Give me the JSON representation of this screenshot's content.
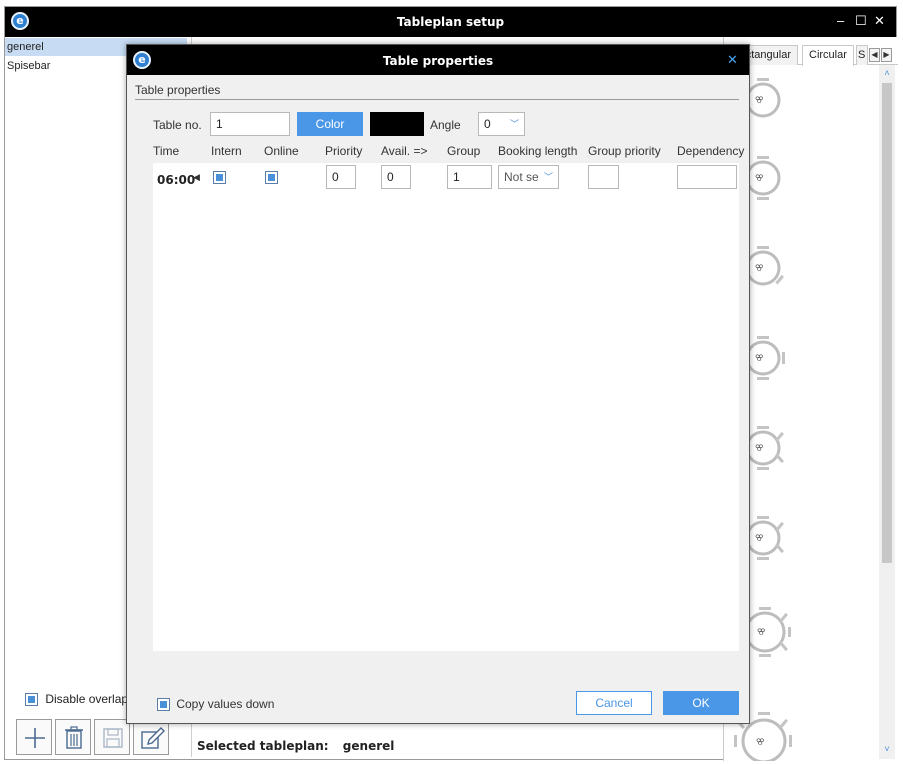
{
  "main_window": {
    "title": "Tableplan setup",
    "controls": {
      "minimize": "–",
      "maximize": "☐",
      "close": "✕"
    }
  },
  "left_list": {
    "items": [
      "generel",
      "Spisebar"
    ],
    "selected": "generel"
  },
  "right_panel": {
    "tabs": [
      {
        "label": "Rectangular",
        "active": false
      },
      {
        "label": "Circular",
        "active": true
      },
      {
        "label": "S",
        "active": false
      }
    ],
    "tab_arrows": {
      "left": "◀",
      "right": "▶"
    },
    "scroll": {
      "up": "˄",
      "down": "˅"
    },
    "table_icon_glyph": "ꕢ"
  },
  "bottom": {
    "disable_overlap_label": "Disable overlap",
    "disable_overlap_checked": true,
    "selected_tableplan_label": "Selected tableplan:",
    "selected_tableplan_value": "generel"
  },
  "dialog": {
    "title": "Table properties",
    "close_glyph": "✕",
    "section_label": "Table properties",
    "table_no_label": "Table no.",
    "table_no_value": "1",
    "color_button_label": "Color",
    "color_value": "#000000",
    "angle_label": "Angle",
    "angle_value": "0",
    "columns": [
      "Time",
      "Intern",
      "Online",
      "Priority",
      "Avail. =>",
      "Group",
      "Booking length",
      "Group priority",
      "Dependency"
    ],
    "rows": [
      {
        "time": "06:00",
        "intern": true,
        "online": true,
        "priority": "0",
        "avail": "0",
        "group": "1",
        "booking_length": "Not se",
        "group_priority": "",
        "dependency": ""
      }
    ],
    "copy_values_label": "Copy values down",
    "copy_values_checked": true,
    "cancel_label": "Cancel",
    "ok_label": "OK"
  },
  "colors": {
    "accent": "#4a97e8",
    "titlebar": "#000000",
    "selection": "#c7dcf3"
  }
}
